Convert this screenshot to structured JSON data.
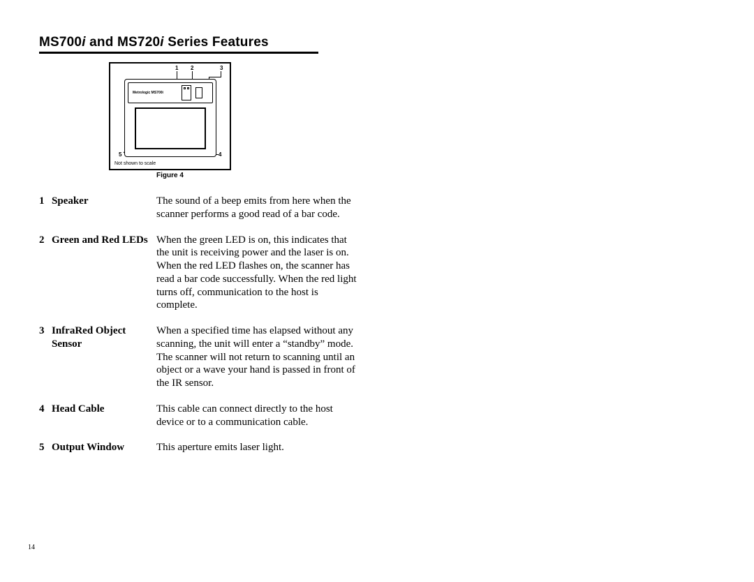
{
  "title": {
    "p1": "MS700",
    "i1": "i",
    "p2": " and MS720",
    "i2": "i",
    "p3": " Series Features"
  },
  "figure": {
    "caption": "Figure 4",
    "model_label": "Metrologic MS700i",
    "not_to_scale": "Not shown to scale",
    "callouts": {
      "n1": "1",
      "n2": "2",
      "n3": "3",
      "n4": "4",
      "n5": "5"
    }
  },
  "features": [
    {
      "num": "1",
      "name": "Speaker",
      "desc": "The sound of a beep emits from here when the scanner performs a good read of a bar code."
    },
    {
      "num": "2",
      "name": "Green and Red LEDs",
      "desc": "When the green LED is on, this indicates that the unit is receiving power and the laser is on. When the red LED flashes on, the scanner has read a bar code successfully. When the red light turns off, communication to the host is complete."
    },
    {
      "num": "3",
      "name": "InfraRed Object Sensor",
      "desc": "When a specified time has elapsed without any scanning, the unit will enter a “standby” mode. The scanner will not return to scanning until an object or a wave your hand is passed in front of the IR sensor."
    },
    {
      "num": "4",
      "name": "Head Cable",
      "desc": "This cable can connect directly to the host device or to a communication cable."
    },
    {
      "num": "5",
      "name": "Output Window",
      "desc": "This aperture emits laser light."
    }
  ],
  "page_number": "14"
}
